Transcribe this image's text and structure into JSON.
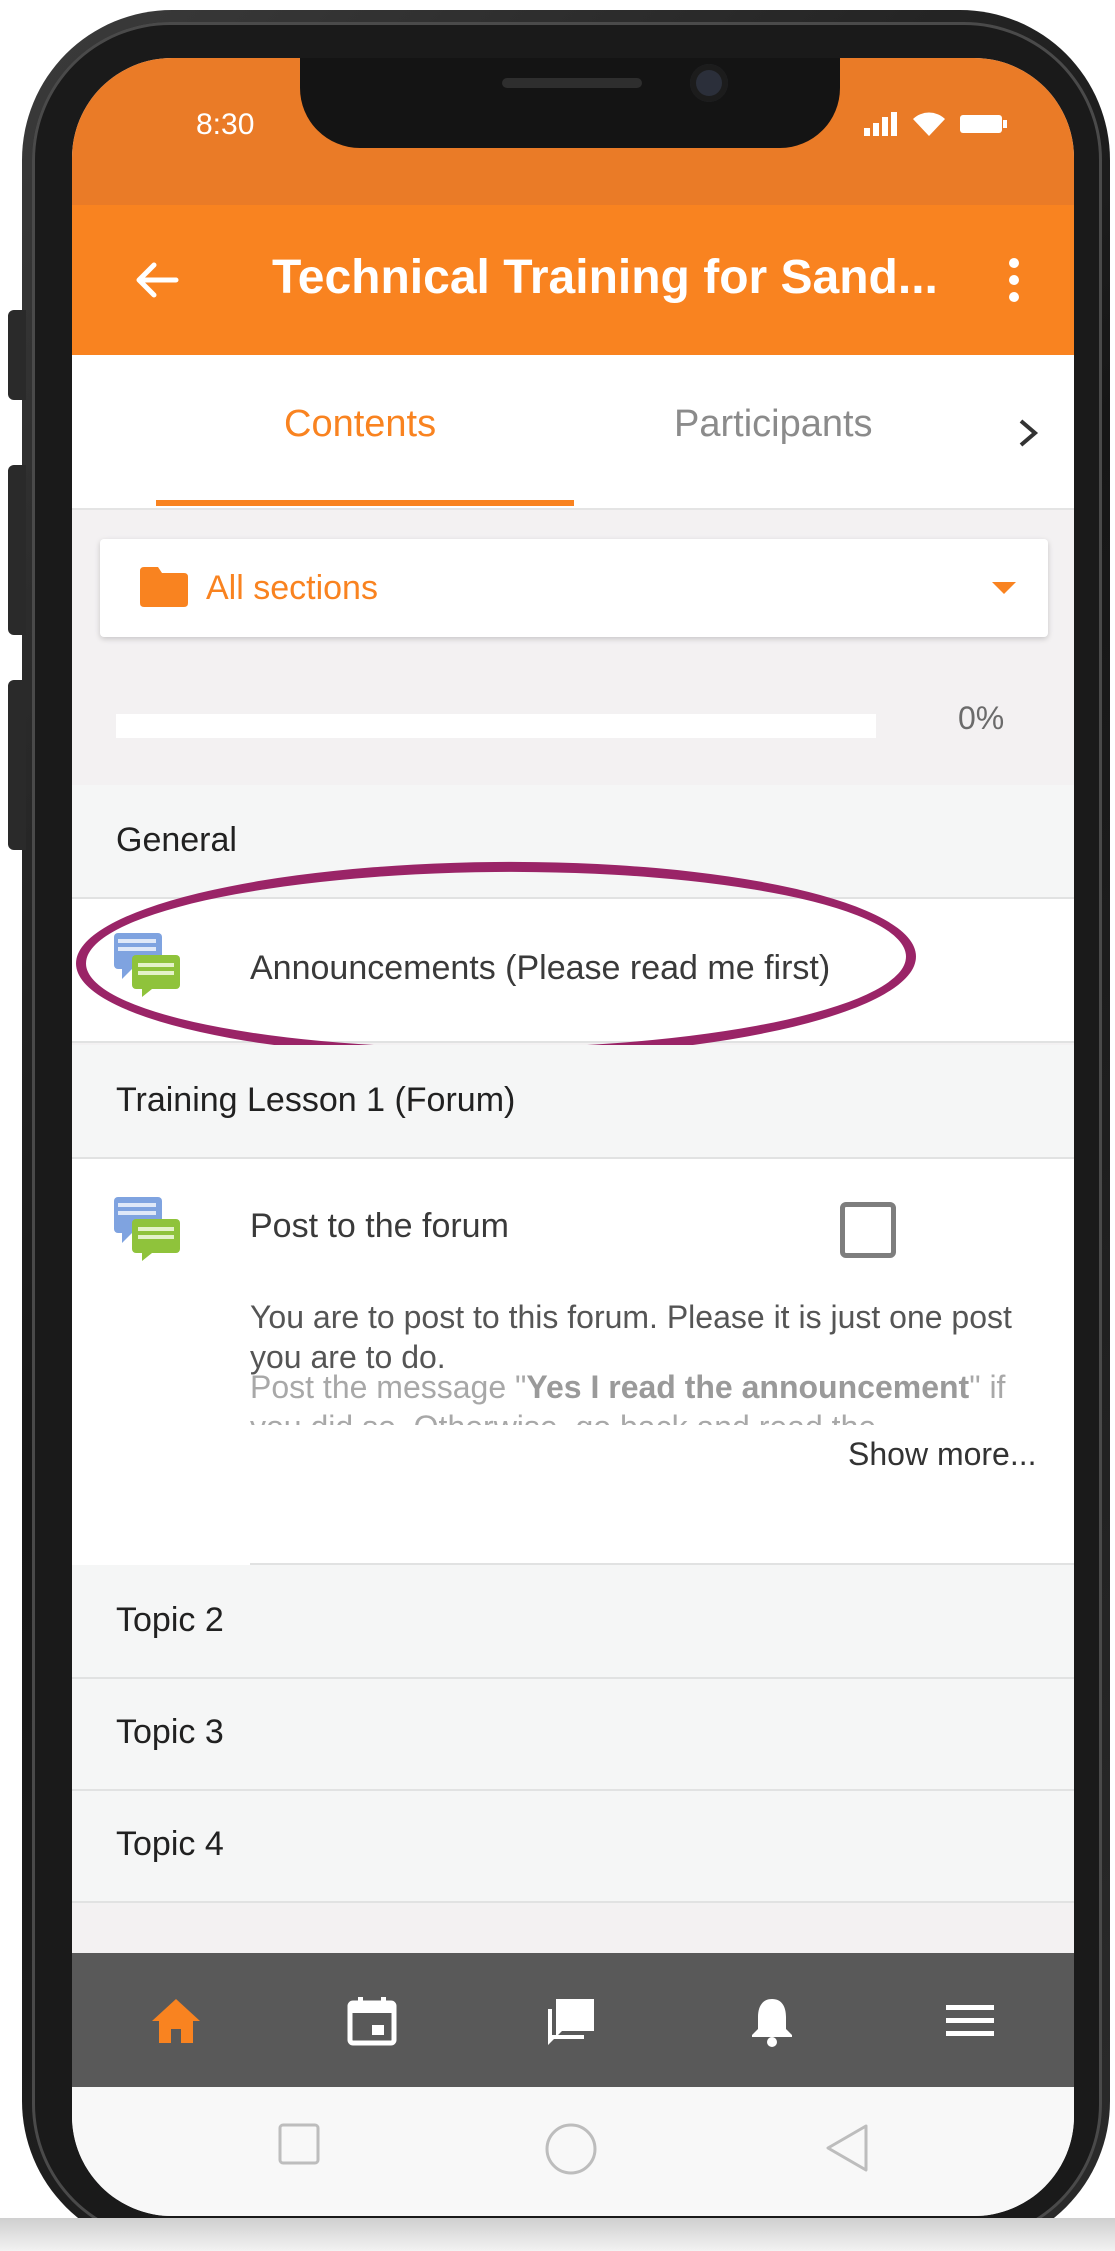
{
  "status_bar": {
    "time": "8:30"
  },
  "toolbar": {
    "title": "Technical Training for Sand...",
    "back_icon": "arrow-left-icon",
    "more_icon": "more-vertical-icon"
  },
  "tabs": [
    {
      "label": "Contents",
      "selected": true
    },
    {
      "label": "Participants",
      "selected": false
    }
  ],
  "sections_select": {
    "selected": "All sections",
    "icon": "folder-icon"
  },
  "progress": {
    "value": 0,
    "label": "0%"
  },
  "course": {
    "general": {
      "title": "General",
      "items": [
        {
          "name": "Announcements (Please read me first)",
          "icon": "forum-icon"
        }
      ]
    },
    "lesson1": {
      "title": "Training Lesson 1 (Forum)",
      "item": {
        "name": "Post to the forum",
        "icon": "forum-icon",
        "completed": false,
        "description": "You are to post to this forum. Please it is just one post you are to do.",
        "description2_prefix": "Post the message \"",
        "description2_bold": "Yes I read the announcement",
        "description2_suffix": "\" if you did so. Otherwise, go back and read the",
        "show_more": "Show more..."
      }
    },
    "topics": [
      "Topic 2",
      "Topic 3",
      "Topic 4"
    ]
  },
  "bottom_nav": [
    {
      "name": "home",
      "icon": "home-icon",
      "active": true
    },
    {
      "name": "calendar",
      "icon": "calendar-icon",
      "active": false
    },
    {
      "name": "messages",
      "icon": "chat-icon",
      "active": false
    },
    {
      "name": "notifications",
      "icon": "bell-icon",
      "active": false
    },
    {
      "name": "menu",
      "icon": "menu-icon",
      "active": false
    }
  ],
  "colors": {
    "brand": "#f98320",
    "status_bar": "#ea7b27",
    "highlight": "#9a2467",
    "nav_bg": "#595959"
  }
}
